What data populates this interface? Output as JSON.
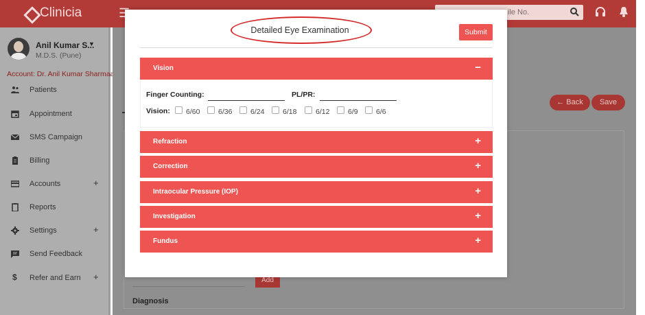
{
  "app": {
    "name": "Clinicia"
  },
  "header": {
    "search_placeholder": "Search by Name or Mobile No.",
    "search_visible_text": "ile No."
  },
  "user": {
    "name": "Anil Kumar S...",
    "subtitle": "M.D.S. (Pune)",
    "account": "Account: Dr. Anil Kumar Sharmaa"
  },
  "sidebar": {
    "items": [
      {
        "label": "Patients",
        "icon": "people-icon",
        "expandable": false
      },
      {
        "label": "Appointment",
        "icon": "calendar-icon",
        "expandable": false
      },
      {
        "label": "SMS Campaign",
        "icon": "mail-icon",
        "expandable": false
      },
      {
        "label": "Billing",
        "icon": "clipboard-icon",
        "expandable": false
      },
      {
        "label": "Accounts",
        "icon": "card-icon",
        "expandable": true
      },
      {
        "label": "Reports",
        "icon": "report-icon",
        "expandable": false
      },
      {
        "label": "Settings",
        "icon": "gear-icon",
        "expandable": true
      },
      {
        "label": "Send Feedback",
        "icon": "feedback-icon",
        "expandable": false
      },
      {
        "label": "Refer and Earn",
        "icon": "dollar-icon",
        "expandable": true
      }
    ],
    "plus_symbol": "+"
  },
  "background": {
    "back_label": "← Back",
    "save_label": "Save",
    "add_label": "Add",
    "diagnosis_label": "Diagnosis"
  },
  "modal": {
    "title": "Detailed Eye Examination",
    "submit_label": "Submit",
    "sections": [
      {
        "label": "Vision",
        "expanded": true,
        "toggle": "−"
      },
      {
        "label": "Refraction",
        "expanded": false,
        "toggle": "+"
      },
      {
        "label": "Correction",
        "expanded": false,
        "toggle": "+"
      },
      {
        "label": "Intraocular Pressure (IOP)",
        "expanded": false,
        "toggle": "+"
      },
      {
        "label": "Investigation",
        "expanded": false,
        "toggle": "+"
      },
      {
        "label": "Fundus",
        "expanded": false,
        "toggle": "+"
      }
    ],
    "vision": {
      "finger_counting_label": "Finger Counting:",
      "finger_counting_value": "",
      "pl_pr_label": "PL/PR:",
      "pl_pr_value": "",
      "vision_label": "Vision:",
      "options": [
        {
          "label": "6/60",
          "checked": false
        },
        {
          "label": "6/36",
          "checked": false
        },
        {
          "label": "6/24",
          "checked": false
        },
        {
          "label": "6/18",
          "checked": false
        },
        {
          "label": "6/12",
          "checked": false
        },
        {
          "label": "6/9",
          "checked": false
        },
        {
          "label": "6/6",
          "checked": false
        }
      ]
    }
  },
  "colors": {
    "accent": "#ee5451",
    "topbar": "#b23a37",
    "annotation_ring": "#d42a2a"
  }
}
